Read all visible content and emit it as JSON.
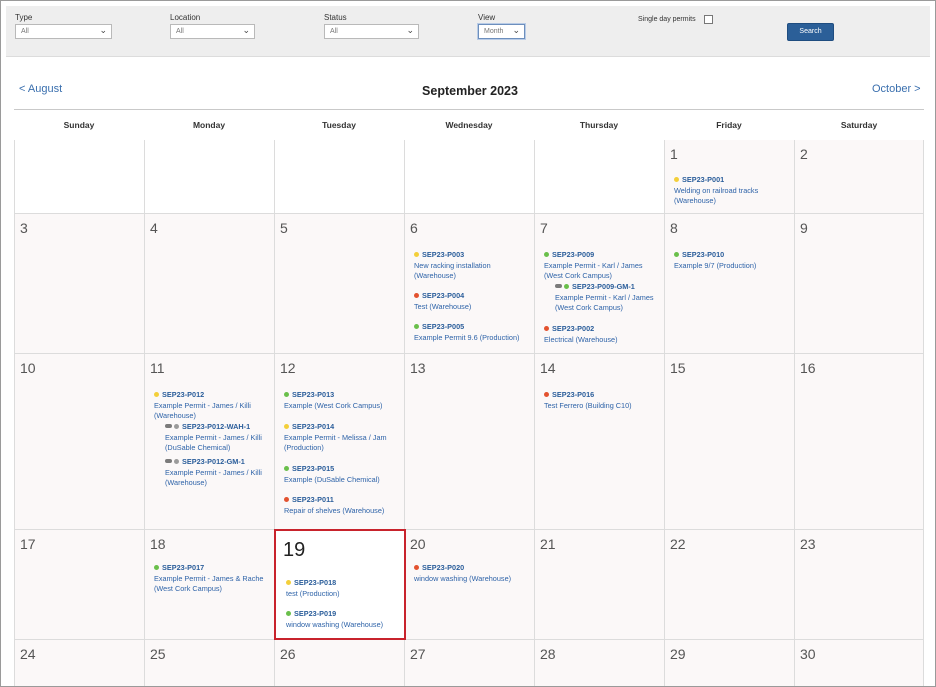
{
  "filters": {
    "type_label": "Type",
    "type_value": "All",
    "location_label": "Location",
    "location_value": "All",
    "status_label": "Status",
    "status_value": "All",
    "view_label": "View",
    "view_value": "Month",
    "single_day_label": "Single day permits",
    "search_label": "Search"
  },
  "nav": {
    "prev": "< August",
    "next": "October >",
    "title": "September 2023"
  },
  "days": [
    "Sunday",
    "Monday",
    "Tuesday",
    "Wednesday",
    "Thursday",
    "Friday",
    "Saturday"
  ],
  "weeks": [
    {
      "nums": [
        "",
        "",
        "",
        "",
        "",
        "1",
        "2"
      ]
    },
    {
      "nums": [
        "3",
        "4",
        "5",
        "6",
        "7",
        "8",
        "9"
      ]
    },
    {
      "nums": [
        "10",
        "11",
        "12",
        "13",
        "14",
        "15",
        "16"
      ]
    },
    {
      "nums": [
        "17",
        "18",
        "19",
        "20",
        "21",
        "22",
        "23"
      ]
    },
    {
      "nums": [
        "24",
        "25",
        "26",
        "27",
        "28",
        "29",
        "30"
      ]
    }
  ],
  "events": {
    "p001": {
      "code": "SEP23-P001",
      "desc": "Welding on railroad tracks (Warehouse)",
      "status": "yellow"
    },
    "p003": {
      "code": "SEP23-P003",
      "desc": "New racking installation (Warehouse)",
      "status": "yellow"
    },
    "p004": {
      "code": "SEP23-P004",
      "desc": "Test (Warehouse)",
      "status": "red"
    },
    "p005": {
      "code": "SEP23-P005",
      "desc": "Example Permit 9.6 (Production)",
      "status": "green"
    },
    "p009": {
      "code": "SEP23-P009",
      "desc": "Example Permit - Karl / James (West Cork Campus)",
      "status": "green"
    },
    "p009gm": {
      "code": "SEP23-P009-GM-1",
      "desc": "Example Permit - Karl / James (West Cork Campus)",
      "status": "green"
    },
    "p002": {
      "code": "SEP23-P002",
      "desc": "Electrical (Warehouse)",
      "status": "red"
    },
    "p010": {
      "code": "SEP23-P010",
      "desc": "Example 9/7 (Production)",
      "status": "green"
    },
    "p012": {
      "code": "SEP23-P012",
      "desc": "Example Permit - James / Killi (Warehouse)",
      "status": "yellow"
    },
    "p012wah": {
      "code": "SEP23-P012-WAH-1",
      "desc": "Example Permit - James / Killi (DuSable Chemical)",
      "status": "grey"
    },
    "p012gm": {
      "code": "SEP23-P012-GM-1",
      "desc": "Example Permit - James / Killi (Warehouse)",
      "status": "grey"
    },
    "p013": {
      "code": "SEP23-P013",
      "desc": "Example (West Cork Campus)",
      "status": "green"
    },
    "p014": {
      "code": "SEP23-P014",
      "desc": "Example Permit - Melissa / Jam (Production)",
      "status": "yellow"
    },
    "p015": {
      "code": "SEP23-P015",
      "desc": "Example (DuSable Chemical)",
      "status": "green"
    },
    "p011": {
      "code": "SEP23-P011",
      "desc": "Repair of shelves (Warehouse)",
      "status": "red"
    },
    "p016": {
      "code": "SEP23-P016",
      "desc": "Test Ferrero (Building C10)",
      "status": "red"
    },
    "p017": {
      "code": "SEP23-P017",
      "desc": "Example Permit - James & Rache (West Cork Campus)",
      "status": "green"
    },
    "p018": {
      "code": "SEP23-P018",
      "desc": "test (Production)",
      "status": "yellow"
    },
    "p019": {
      "code": "SEP23-P019",
      "desc": "window washing (Warehouse)",
      "status": "green"
    },
    "p020": {
      "code": "SEP23-P020",
      "desc": "window washing (Warehouse)",
      "status": "red"
    }
  },
  "colors": {
    "yellow": "#f3cf3a",
    "green": "#6abf4b",
    "red": "#e3522f",
    "grey": "#9b9b9b",
    "link": "#2e63a8",
    "highlight": "#c8232c",
    "search_button": "#2b5f98"
  }
}
